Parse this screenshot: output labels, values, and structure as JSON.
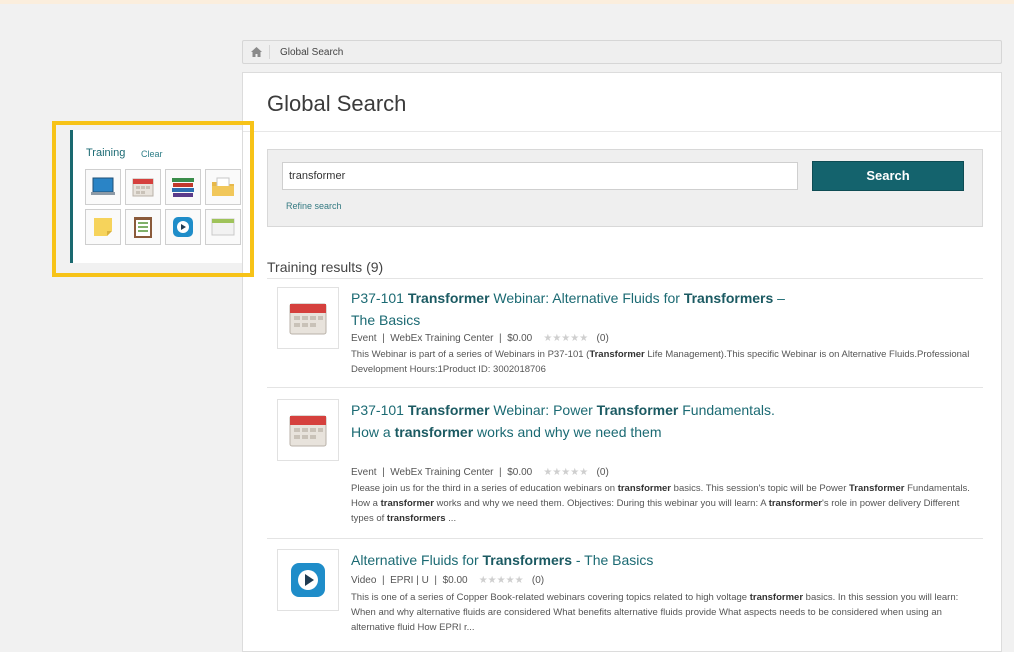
{
  "breadcrumb": {
    "current": "Global Search"
  },
  "page": {
    "title": "Global Search"
  },
  "search": {
    "value": "transformer",
    "button_label": "Search",
    "refine_label": "Refine search"
  },
  "results": {
    "heading": "Training results (9)",
    "items": [
      {
        "title_parts": [
          "P37-101 ",
          "Transformer",
          " Webinar: Alternative Fluids for ",
          "Transformers",
          " – The Basics"
        ],
        "icon": "calendar-icon",
        "type": "Event",
        "provider": "WebEx Training Center",
        "price": "$0.00",
        "rating_count": "(0)",
        "description_parts": [
          "This Webinar is part of a series of Webinars in P37-101 (",
          "Transformer",
          " Life Management).This specific Webinar is on Alternative Fluids.Professional Development Hours:1Product ID: 3002018706"
        ]
      },
      {
        "title_parts": [
          "P37-101 ",
          "Transformer",
          " Webinar: Power ",
          "Transformer",
          " Fundamentals. How a ",
          "transformer",
          " works and why we need them"
        ],
        "icon": "calendar-icon",
        "type": "Event",
        "provider": "WebEx Training Center",
        "price": "$0.00",
        "rating_count": "(0)",
        "description_parts": [
          "Please join us for the third in a series of education webinars on ",
          "transformer",
          " basics.  This session's topic will be Power ",
          "Transformer",
          " Fundamentals.  How a ",
          "transformer",
          " works and why we need them.  Objectives: During this webinar you will learn: A ",
          "transformer",
          "'s role in power delivery Different types of ",
          "transformers",
          " ..."
        ]
      },
      {
        "title_parts": [
          "Alternative Fluids for ",
          "Transformers",
          " - The Basics"
        ],
        "icon": "video-play-icon",
        "type": "Video",
        "provider": "EPRI | U",
        "price": "$0.00",
        "rating_count": "(0)",
        "description_parts": [
          "This is one of a series of Copper Book-related webinars covering topics related to high voltage ",
          "transformer",
          " basics. In this session you will learn:  When and why alternative fluids are considered  What benefits alternative fluids provide  What aspects needs to be considered when using an alternative fluid  How EPRI r..."
        ]
      }
    ]
  },
  "filter": {
    "title": "Training",
    "clear_label": "Clear",
    "tiles": [
      "laptop-icon",
      "calendar-icon",
      "books-icon",
      "folder-icon",
      "sticky-note-icon",
      "checklist-icon",
      "video-play-icon",
      "window-icon"
    ]
  },
  "colors": {
    "accent": "#14636d",
    "link": "#1b6a73",
    "highlight": "#f7c318"
  }
}
